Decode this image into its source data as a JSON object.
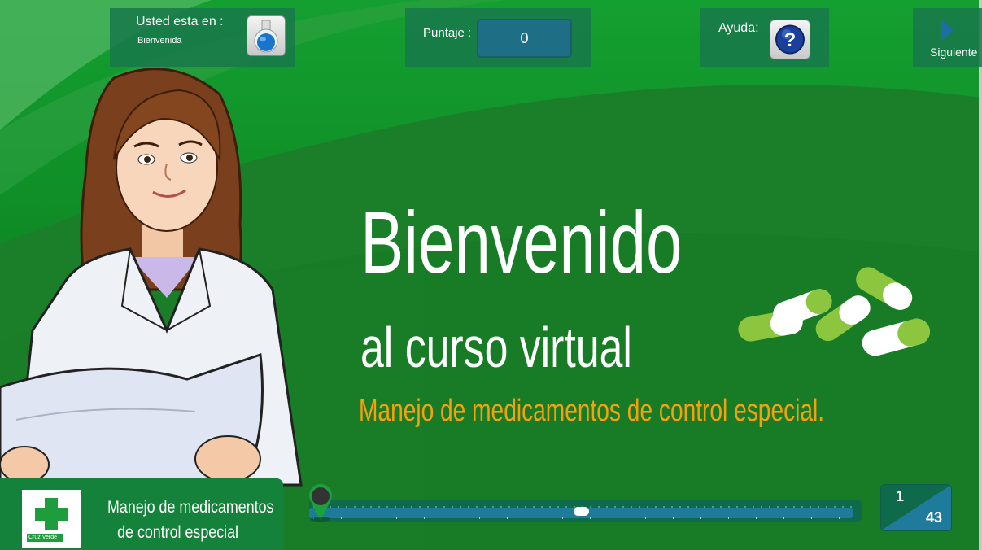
{
  "header": {
    "location_label": "Usted esta en :",
    "location_value": "Bienvenida",
    "score_label": "Puntaje :",
    "score_value": "0",
    "help_label": "Ayuda:",
    "next_label": "Siguiente"
  },
  "main": {
    "headline": "Bienvenido",
    "subheadline": "al curso virtual",
    "course_title": "Manejo de medicamentos de control especial."
  },
  "brand": {
    "logo_text": "Cruz Verde",
    "title_line1": "Manejo de medicamentos",
    "title_line2": "de control especial"
  },
  "pagination": {
    "current": "1",
    "total": "43",
    "progress_fraction": 0.5
  },
  "colors": {
    "background_green": "#1f7f2a",
    "accent_orange": "#f5a10d",
    "panel_teal": "#1e6f86",
    "pill_light_green": "#8cc63f"
  },
  "icons": {
    "location": "flask-icon",
    "help": "question-icon",
    "next": "play-arrow-icon",
    "timeline_start": "map-pin-icon"
  }
}
